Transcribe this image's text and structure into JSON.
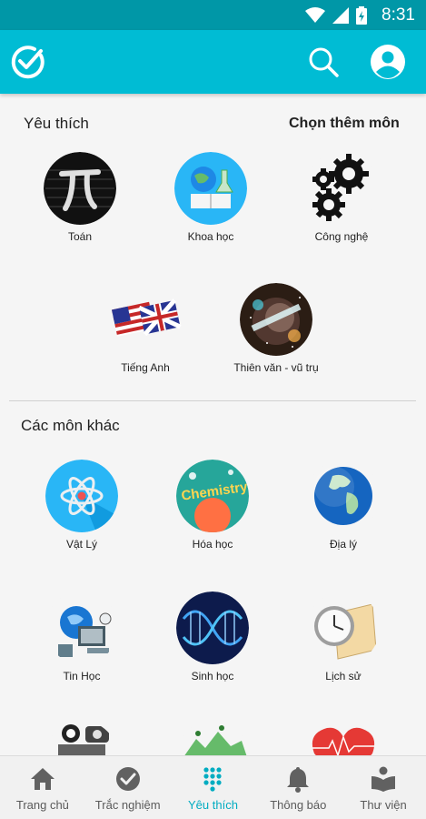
{
  "status_bar": {
    "time": "8:31"
  },
  "app_bar": {
    "logo_icon": "check-circle-icon",
    "search_icon": "search-icon",
    "account_icon": "account-circle-icon",
    "color": "#00bcd4"
  },
  "favorites": {
    "title": "Yêu thích",
    "add_more": "Chọn thêm môn",
    "items": [
      {
        "label": "Toán",
        "icon": "pi-icon"
      },
      {
        "label": "Khoa học",
        "icon": "science-icon"
      },
      {
        "label": "Công nghệ",
        "icon": "gears-icon"
      },
      {
        "label": "Tiếng Anh",
        "icon": "uk-us-flag-icon"
      },
      {
        "label": "Thiên văn - vũ trụ",
        "icon": "universe-icon"
      }
    ]
  },
  "others": {
    "title": "Các môn khác",
    "items": [
      {
        "label": "Vật Lý",
        "icon": "atom-icon"
      },
      {
        "label": "Hóa học",
        "icon": "chemistry-icon"
      },
      {
        "label": "Địa lý",
        "icon": "globe-icon"
      },
      {
        "label": "Tin Học",
        "icon": "computer-icon"
      },
      {
        "label": "Sinh học",
        "icon": "dna-icon"
      },
      {
        "label": "Lịch sử",
        "icon": "clock-scroll-icon"
      },
      {
        "label": "",
        "icon": "robot-icon"
      },
      {
        "label": "",
        "icon": "landscape-icon"
      },
      {
        "label": "",
        "icon": "heart-icon"
      }
    ]
  },
  "bottom_nav": {
    "active_color": "#00acc1",
    "items": [
      {
        "label": "Trang chủ",
        "icon": "home-icon"
      },
      {
        "label": "Trắc nghiệm",
        "icon": "check-circle-icon"
      },
      {
        "label": "Yêu thích",
        "icon": "dialpad-icon"
      },
      {
        "label": "Thông báo",
        "icon": "bell-icon"
      },
      {
        "label": "Thư viện",
        "icon": "book-reader-icon"
      }
    ]
  }
}
